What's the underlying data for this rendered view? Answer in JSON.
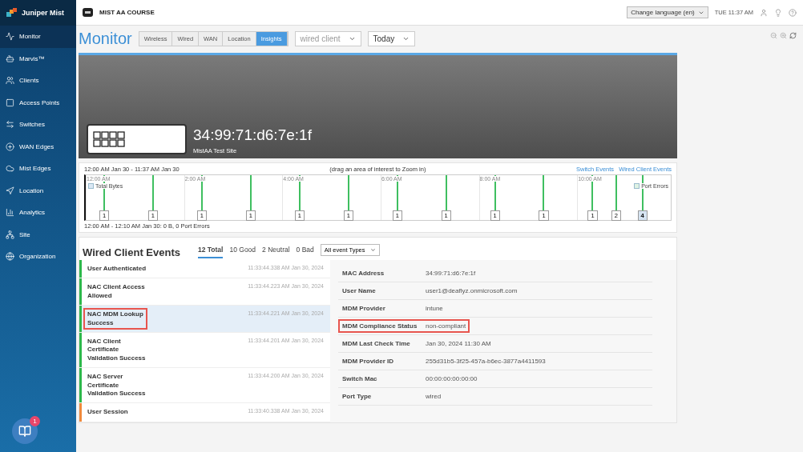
{
  "sidebar": {
    "brand": "Juniper Mist",
    "items": [
      {
        "label": "Monitor",
        "selected": true
      },
      {
        "label": "Marvis™",
        "selected": false
      },
      {
        "label": "Clients",
        "selected": false
      },
      {
        "label": "Access Points",
        "selected": false
      },
      {
        "label": "Switches",
        "selected": false
      },
      {
        "label": "WAN Edges",
        "selected": false
      },
      {
        "label": "Mist Edges",
        "selected": false
      },
      {
        "label": "Location",
        "selected": false
      },
      {
        "label": "Analytics",
        "selected": false
      },
      {
        "label": "Site",
        "selected": false
      },
      {
        "label": "Organization",
        "selected": false
      }
    ],
    "chat_badge": "1"
  },
  "header": {
    "org": "MIST AA COURSE",
    "language": "Change language (en)",
    "time": "TUE 11:37 AM"
  },
  "page": {
    "title": "Monitor",
    "tabs": [
      {
        "label": "Wireless",
        "selected": false
      },
      {
        "label": "Wired",
        "selected": false
      },
      {
        "label": "WAN",
        "selected": false
      },
      {
        "label": "Location",
        "selected": false
      },
      {
        "label": "Insights",
        "selected": true
      }
    ],
    "client_select": "wired client",
    "period_select": "Today"
  },
  "hero": {
    "mac": "34:99:71:d6:7e:1f",
    "site": "MistAA Test Site"
  },
  "timeline": {
    "range": "12:00 AM Jan 30 - 11:37 AM Jan 30",
    "hint": "(drag an area of interest to Zoom in)",
    "links": [
      "Switch Events",
      "Wired Client Events"
    ],
    "hours": [
      "12:00 AM",
      "2:00 AM",
      "4:00 AM",
      "6:00 AM",
      "8:00 AM",
      "10:00 AM"
    ],
    "legend_left": "Total Bytes",
    "legend_right": "Port Errors",
    "markers": [
      {
        "count": "1",
        "selected": false
      },
      {
        "count": "1",
        "selected": false
      },
      {
        "count": "1",
        "selected": false
      },
      {
        "count": "1",
        "selected": false
      },
      {
        "count": "1",
        "selected": false
      },
      {
        "count": "1",
        "selected": false
      },
      {
        "count": "1",
        "selected": false
      },
      {
        "count": "1",
        "selected": false
      },
      {
        "count": "1",
        "selected": false
      },
      {
        "count": "1",
        "selected": false
      },
      {
        "count": "1",
        "selected": false
      },
      {
        "count": "2",
        "selected": false
      },
      {
        "count": "4",
        "selected": true
      }
    ],
    "summary": "12:00 AM - 12:10 AM Jan 30: 0 B, 0 Port Errors"
  },
  "events": {
    "title": "Wired Client Events",
    "filters": [
      {
        "label": "12 Total",
        "selected": true
      },
      {
        "label": "10 Good",
        "selected": false
      },
      {
        "label": "2 Neutral",
        "selected": false
      },
      {
        "label": "0 Bad",
        "selected": false
      }
    ],
    "type_select": "All event Types",
    "items": [
      {
        "name": "User Authenticated",
        "time": "11:33:44.338 AM Jan 30, 2024",
        "color": "#2db84b",
        "selected": false,
        "highlighted": false
      },
      {
        "name": "NAC Client Access\nAllowed",
        "time": "11:33:44.223 AM Jan 30, 2024",
        "color": "#2db84b",
        "selected": false,
        "highlighted": false
      },
      {
        "name": "NAC MDM Lookup\nSuccess",
        "time": "11:33:44.221 AM Jan 30, 2024",
        "color": "#2db84b",
        "selected": true,
        "highlighted": true
      },
      {
        "name": "NAC Client\nCertificate\nValidation Success",
        "time": "11:33:44.201 AM Jan 30, 2024",
        "color": "#2db84b",
        "selected": false,
        "highlighted": false
      },
      {
        "name": "NAC Server\nCertificate\nValidation Success",
        "time": "11:33:44.200 AM Jan 30, 2024",
        "color": "#2db84b",
        "selected": false,
        "highlighted": false
      },
      {
        "name": "User Session",
        "time": "11:33:40.338 AM Jan 30, 2024",
        "color": "#f08a3c",
        "selected": false,
        "highlighted": false
      }
    ],
    "details": [
      {
        "label": "MAC Address",
        "value": "34:99:71:d6:7e:1f",
        "highlighted": false
      },
      {
        "label": "User Name",
        "value": "user1@deaflyz.onmicrosoft.com",
        "highlighted": false
      },
      {
        "label": "MDM Provider",
        "value": "intune",
        "highlighted": false
      },
      {
        "label": "MDM Compliance Status",
        "value": "non-compliant",
        "highlighted": true
      },
      {
        "label": "MDM Last Check Time",
        "value": "Jan 30, 2024 11:30 AM",
        "highlighted": false
      },
      {
        "label": "MDM Provider ID",
        "value": "255d31b5-3f25-457a-b6ec-3877a4411593",
        "highlighted": false
      },
      {
        "label": "Switch Mac",
        "value": "00:00:00:00:00:00",
        "highlighted": false
      },
      {
        "label": "Port Type",
        "value": "wired",
        "highlighted": false
      }
    ]
  }
}
